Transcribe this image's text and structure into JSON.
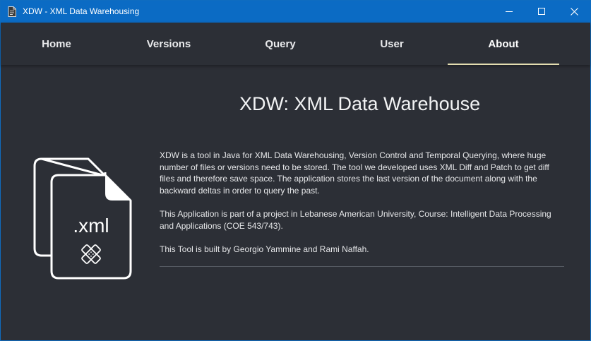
{
  "window": {
    "title": "XDW - XML Data Warehousing"
  },
  "nav": {
    "tabs": [
      {
        "label": "Home"
      },
      {
        "label": "Versions"
      },
      {
        "label": "Query"
      },
      {
        "label": "User"
      },
      {
        "label": "About"
      }
    ],
    "active_tab": "About"
  },
  "about": {
    "heading": "XDW: XML Data Warehouse",
    "graphic_label": ".xml",
    "paragraphs": [
      "XDW is a tool in Java for XML Data Warehousing, Version Control and Temporal Querying, where huge number of files or versions need to be stored. The tool we developed uses XML Diff and Patch to get diff files and therefore save space. The application stores the last version of the document along with the backward deltas in order to query the past.",
      "This Application is part of a project in Lebanese American University, Course:  Intelligent Data Processing and Applications (COE 543/743).",
      "This Tool is built by Georgio Yammine and Rami Naffah."
    ]
  },
  "colors": {
    "titlebar": "#0b6bc4",
    "background": "#2c2f36",
    "accent_underline": "#e4ddb0",
    "text": "#e6e7e9"
  },
  "icons": {
    "app": "document-icon",
    "minimize": "minimize-icon",
    "maximize": "maximize-icon",
    "close": "close-icon",
    "graphic": "xml-files-icon",
    "patch": "patch-icon"
  }
}
